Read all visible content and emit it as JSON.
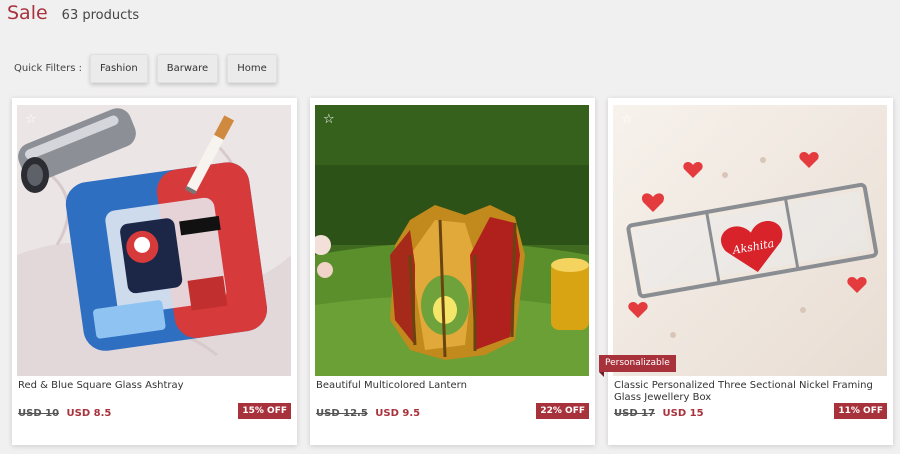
{
  "header": {
    "title": "Sale",
    "count": "63 products"
  },
  "filters": {
    "label": "Quick Filters :",
    "chips": [
      "Fashion",
      "Barware",
      "Home"
    ]
  },
  "products": [
    {
      "name": "Red & Blue Square Glass Ashtray",
      "old_price": "USD 10",
      "new_price": "USD 8.5",
      "discount": "15% OFF"
    },
    {
      "name": "Beautiful Multicolored Lantern",
      "old_price": "USD 12.5",
      "new_price": "USD 9.5",
      "discount": "22% OFF"
    },
    {
      "name": "Classic Personalized Three Sectional Nickel Framing Glass Jewellery Box",
      "old_price": "USD 17",
      "new_price": "USD 15",
      "discount": "11% OFF",
      "ribbon": "Personalizable",
      "engraving": "Akshita"
    }
  ],
  "icons": {
    "favorite": "star-outline-icon"
  },
  "colors": {
    "accent": "#a8323c",
    "background": "#f1f0f0"
  }
}
